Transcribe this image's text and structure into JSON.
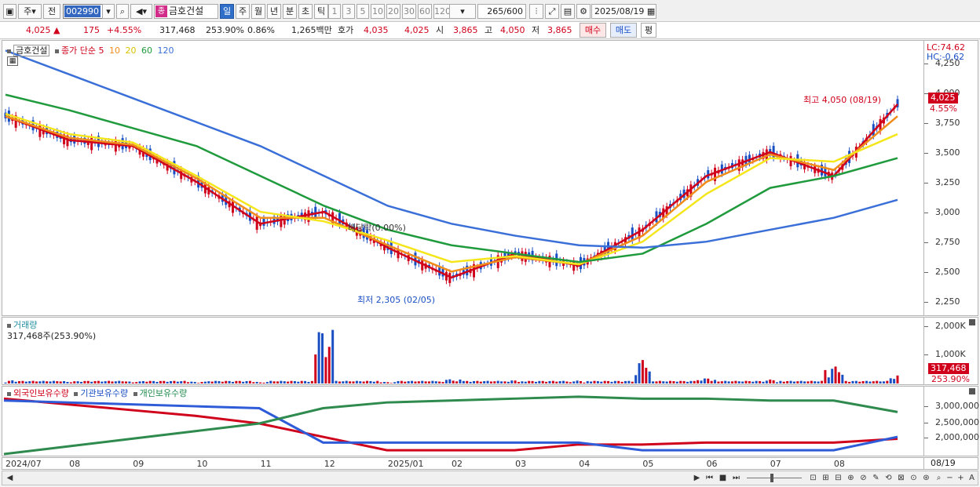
{
  "toolbar": {
    "period_select": "주",
    "prev_label": "전",
    "code": "002990",
    "name_badge": "종",
    "name": "금호건설",
    "periods": [
      "일",
      "주",
      "월",
      "년",
      "분",
      "초",
      "틱"
    ],
    "intervals": [
      "1",
      "3",
      "5",
      "10",
      "20",
      "30",
      "60",
      "120"
    ],
    "count": "265",
    "count_total": "/600",
    "date": "2025/08/19"
  },
  "quote": {
    "price": "4,025",
    "change_arrow": "▲",
    "change": "175",
    "change_pct": "+4.55%",
    "volume": "317,468",
    "volume_ratio": "253.90%",
    "turnover_pct": "0.86%",
    "amount": "1,265백만",
    "ask_label": "호가",
    "ask": "4,035",
    "bid": "4,025",
    "open_label": "시",
    "open": "3,865",
    "high_label": "고",
    "high": "4,050",
    "low_label": "저",
    "low": "3,865",
    "buy_label": "매수",
    "sell_label": "매도",
    "eval_label": "평"
  },
  "price_panel": {
    "legend_name": "금호건설",
    "legend_ma": "종가 단순 5",
    "ma_periods": [
      "10",
      "20",
      "60",
      "120"
    ],
    "lc": "LC:74.62",
    "hc": "HC:-0.62",
    "y_ticks": [
      "4,250",
      "4,000",
      "3,750",
      "3,500",
      "3,250",
      "3,000",
      "2,750",
      "2,500",
      "2,250"
    ],
    "current_tag": "4,025",
    "current_pct": "4.55%",
    "high_note": "최고 4,050 (08/19)",
    "low_note": "최저 2,305 (02/05)",
    "dividend_note": "배당락(0.00%)"
  },
  "volume_panel": {
    "title": "거래량",
    "value": "317,468주(253.90%)",
    "y_ticks": [
      "2,000K",
      "1,000K"
    ],
    "current_tag": "317,468",
    "current_pct": "253.90%"
  },
  "holding_panel": {
    "legend": [
      "외국인보유수량",
      "기관보유수량",
      "개인보유수량"
    ],
    "y_ticks": [
      "3,000,000",
      "2,500,000",
      "2,000,000"
    ]
  },
  "x_axis": {
    "labels": [
      "2024/07",
      "08",
      "09",
      "10",
      "11",
      "12",
      "2025/01",
      "02",
      "03",
      "04",
      "05",
      "06",
      "07",
      "08"
    ],
    "right_label": "08/19"
  },
  "colors": {
    "up": "#d0021b",
    "down": "#1a4fc4",
    "ma5": "#d0021b",
    "ma10": "#f08c1a",
    "ma20": "#f5e61c",
    "ma60": "#1f9a3c",
    "ma120": "#3a6fd8"
  },
  "chart_data": [
    {
      "type": "line",
      "title": "",
      "ylabel": "",
      "ylim": [
        2200,
        4300
      ],
      "x": [
        "2024/07",
        "08",
        "09",
        "10",
        "11",
        "12",
        "2025/01",
        "02",
        "03",
        "04",
        "05",
        "06",
        "07",
        "08",
        "08/19"
      ],
      "series": [
        {
          "name": "종가 단순 5",
          "values": [
            3800,
            3600,
            3550,
            3250,
            2900,
            3000,
            2700,
            2450,
            2650,
            2550,
            2850,
            3300,
            3500,
            3300,
            3900
          ]
        },
        {
          "name": "10",
          "values": [
            3800,
            3620,
            3560,
            3280,
            2950,
            2950,
            2720,
            2500,
            2620,
            2560,
            2800,
            3250,
            3480,
            3350,
            3800
          ]
        },
        {
          "name": "20",
          "values": [
            3820,
            3650,
            3580,
            3300,
            3000,
            2920,
            2760,
            2580,
            2630,
            2560,
            2750,
            3150,
            3450,
            3420,
            3650
          ]
        },
        {
          "name": "60",
          "values": [
            3980,
            3850,
            3700,
            3550,
            3300,
            3050,
            2850,
            2720,
            2650,
            2580,
            2650,
            2900,
            3200,
            3300,
            3450
          ]
        },
        {
          "name": "120",
          "values": [
            4350,
            4150,
            3950,
            3750,
            3550,
            3300,
            3050,
            2900,
            2800,
            2720,
            2700,
            2750,
            2850,
            2950,
            3100
          ]
        }
      ]
    },
    {
      "type": "bar",
      "title": "거래량",
      "categories": [
        "2024/07",
        "08",
        "09",
        "10",
        "11",
        "12",
        "2025/01",
        "02",
        "03",
        "04",
        "05",
        "06",
        "07",
        "08",
        "08/19"
      ],
      "values": [
        120,
        90,
        80,
        70,
        60,
        2050,
        60,
        160,
        120,
        110,
        900,
        200,
        150,
        650,
        317
      ],
      "ylim": [
        0,
        2200
      ]
    },
    {
      "type": "line",
      "title": "",
      "x": [
        "2024/07",
        "08",
        "09",
        "10",
        "11",
        "12",
        "2025/01",
        "02",
        "03",
        "04",
        "05",
        "06",
        "07",
        "08",
        "08/19"
      ],
      "series": [
        {
          "name": "외국인보유수량",
          "values": [
            3150000,
            3000000,
            2850000,
            2700000,
            2500000,
            2150000,
            1800000,
            1800000,
            1800000,
            1950000,
            1950000,
            2000000,
            2000000,
            2000000,
            2100000
          ]
        },
        {
          "name": "기관보유수량",
          "values": [
            3100000,
            3050000,
            3000000,
            2950000,
            2900000,
            2000000,
            2000000,
            2000000,
            2000000,
            2000000,
            1800000,
            1800000,
            1800000,
            1800000,
            2150000
          ]
        },
        {
          "name": "개인보유수량",
          "values": [
            1700000,
            1900000,
            2100000,
            2300000,
            2500000,
            2900000,
            3050000,
            3100000,
            3150000,
            3200000,
            3150000,
            3150000,
            3100000,
            3100000,
            2800000
          ]
        }
      ],
      "ylim": [
        1700000,
        3300000
      ]
    }
  ]
}
